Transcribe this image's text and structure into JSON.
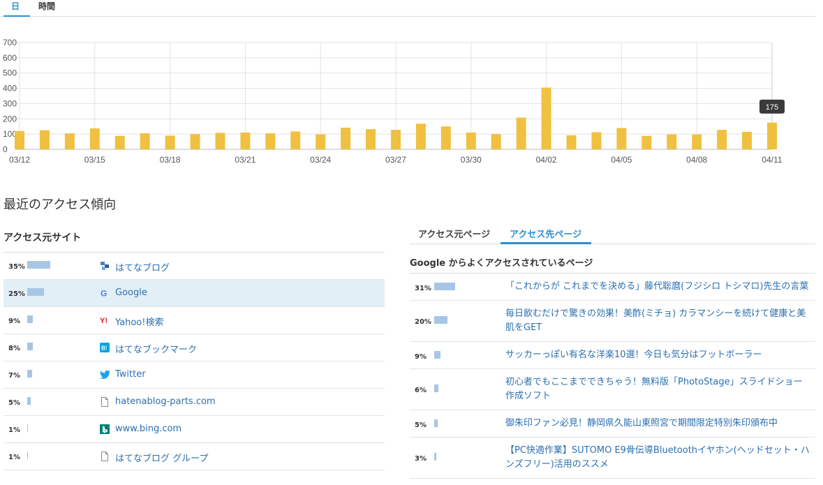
{
  "tabs": [
    {
      "label": "日",
      "active": true
    },
    {
      "label": "時間",
      "active": false
    }
  ],
  "chart_data": {
    "type": "bar",
    "categories": [
      "03/12",
      "03/13",
      "03/14",
      "03/15",
      "03/16",
      "03/17",
      "03/18",
      "03/19",
      "03/20",
      "03/21",
      "03/22",
      "03/23",
      "03/24",
      "03/25",
      "03/26",
      "03/27",
      "03/28",
      "03/29",
      "03/30",
      "03/31",
      "04/01",
      "04/02",
      "04/03",
      "04/04",
      "04/05",
      "04/06",
      "04/07",
      "04/08",
      "04/09",
      "04/10",
      "04/11"
    ],
    "values": [
      120,
      125,
      105,
      137,
      88,
      105,
      90,
      100,
      108,
      110,
      105,
      117,
      98,
      142,
      132,
      128,
      168,
      150,
      110,
      100,
      208,
      405,
      92,
      112,
      140,
      88,
      98,
      98,
      128,
      115,
      175
    ],
    "x_tick_labels": [
      "03/12",
      "03/15",
      "03/18",
      "03/21",
      "03/24",
      "03/27",
      "03/30",
      "04/02",
      "04/05",
      "04/08",
      "04/11"
    ],
    "y_ticks": [
      "0",
      "100",
      "200",
      "300",
      "400",
      "500",
      "600",
      "700"
    ],
    "ylim": [
      0,
      700
    ],
    "grid": true,
    "bar_color": "#f0c040",
    "tooltip": {
      "category": "04/11",
      "text": "175"
    }
  },
  "section_title": "最近のアクセス傾向",
  "sources": {
    "heading": "アクセス元サイト",
    "bar_color": "#a8c6e3",
    "items": [
      {
        "pct": "35%",
        "share": 35,
        "name": "はてなブログ",
        "icon": "hatena-blog-icon",
        "highlight": false
      },
      {
        "pct": "25%",
        "share": 25,
        "name": "Google",
        "icon": "google-icon",
        "highlight": true
      },
      {
        "pct": "9%",
        "share": 9,
        "name": "Yahoo!検索",
        "icon": "yahoo-icon",
        "highlight": false
      },
      {
        "pct": "8%",
        "share": 8,
        "name": "はてなブックマーク",
        "icon": "hatena-bookmark-icon",
        "highlight": false
      },
      {
        "pct": "7%",
        "share": 7,
        "name": "Twitter",
        "icon": "twitter-icon",
        "highlight": false
      },
      {
        "pct": "5%",
        "share": 5,
        "name": "hatenablog-parts.com",
        "icon": "page-icon",
        "highlight": false
      },
      {
        "pct": "1%",
        "share": 1,
        "name": "www.bing.com",
        "icon": "bing-icon",
        "highlight": false
      },
      {
        "pct": "1%",
        "share": 1,
        "name": "はてなブログ グループ",
        "icon": "page-icon",
        "highlight": false
      }
    ]
  },
  "pages": {
    "tabs": [
      {
        "label": "アクセス元ページ",
        "active": false
      },
      {
        "label": "アクセス先ページ",
        "active": true
      }
    ],
    "heading": "Google からよくアクセスされているページ",
    "items": [
      {
        "pct": "31%",
        "share": 31,
        "title": "「これからが これまでを決める」藤代聡麿(フジシロ トシマロ)先生の言葉",
        "lines": 1
      },
      {
        "pct": "20%",
        "share": 20,
        "title": "毎日飲むだけで驚きの効果！美酢(ミチョ) カラマンシーを続けて健康と美肌をGET",
        "lines": 2
      },
      {
        "pct": "9%",
        "share": 9,
        "title": "サッカーっぽい有名な洋楽10選！今日も気分はフットボーラー",
        "lines": 1
      },
      {
        "pct": "6%",
        "share": 6,
        "title": "初心者でもここまでできちゃう！無料版「PhotoStage」スライドショー作成ソフト",
        "lines": 2
      },
      {
        "pct": "5%",
        "share": 5,
        "title": "御朱印ファン必見！静岡県久能山東照宮で期間限定特別朱印頒布中",
        "lines": 1
      },
      {
        "pct": "3%",
        "share": 3,
        "title": "【PC快適作業】SUTOMO E9骨伝導Bluetoothイヤホン(ヘッドセット・ハンズフリー)活用のススメ",
        "lines": 2
      }
    ]
  }
}
